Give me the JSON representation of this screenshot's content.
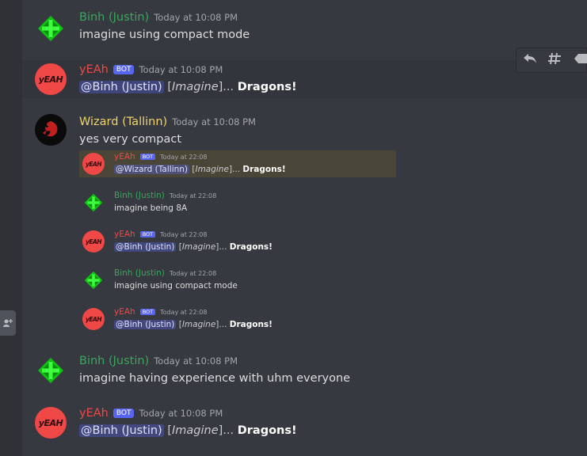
{
  "messages": [
    {
      "user": "Binh (Justin)",
      "time": "Today at 10:08 PM",
      "text": "imagine using compact mode"
    },
    {
      "user": "yEAh",
      "bot": "BOT",
      "time": "Today at 10:08 PM",
      "mention": "@Binh (Justin)",
      "pre": "[",
      "italic": "Imagine",
      "post": "]...",
      "bold": "Dragons!"
    },
    {
      "user": "Wizard (Tallinn)",
      "time": "Today at 10:08 PM",
      "text": "yes very compact"
    },
    {
      "user": "Binh (Justin)",
      "time": "Today at 10:08 PM",
      "text": "imagine having experience with uhm everyone"
    },
    {
      "user": "yEAh",
      "bot": "BOT",
      "time": "Today at 10:08 PM",
      "mention": "@Binh (Justin)",
      "pre": "[",
      "italic": "Imagine",
      "post": "]...",
      "bold": "Dragons!"
    }
  ],
  "embed": [
    {
      "user": "yEAh",
      "bot": "BOT",
      "time": "Today at 22:08",
      "mention": "@Wizard (Tallinn)",
      "pre": "[",
      "italic": "Imagine",
      "post": "]...",
      "bold": "Dragons!"
    },
    {
      "user": "Binh (Justin)",
      "time": "Today at 22:08",
      "text": "imagine being 8A"
    },
    {
      "user": "yEAh",
      "bot": "BOT",
      "time": "Today at 22:08",
      "mention": "@Binh (Justin)",
      "pre": "[",
      "italic": "Imagine",
      "post": "]...",
      "bold": "Dragons!"
    },
    {
      "user": "Binh (Justin)",
      "time": "Today at 22:08",
      "text": "imagine using compact mode"
    },
    {
      "user": "yEAh",
      "bot": "BOT",
      "time": "Today at 22:08",
      "mention": "@Binh (Justin)",
      "pre": "[",
      "italic": "Imagine",
      "post": "]...",
      "bold": "Dragons!"
    }
  ],
  "avatars": {
    "yeah_text": "yEAH"
  },
  "toolbar": {
    "icons": [
      "reply-icon",
      "thread-icon",
      "more-icon"
    ]
  },
  "colors": {
    "green": "#3ba55d",
    "yellow": "#f0d36b",
    "red": "#f04747",
    "bot": "#5865f2"
  }
}
